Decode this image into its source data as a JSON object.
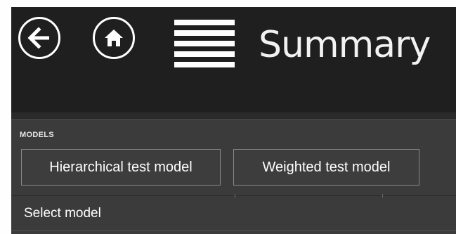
{
  "header": {
    "back_icon": "back-arrow-icon",
    "home_icon": "home-icon",
    "menu_icon": "hamburger-menu-icon",
    "title": "Summary"
  },
  "models_section": {
    "label": "MODELS",
    "models": [
      {
        "label": "Hierarchical test model"
      },
      {
        "label": "Weighted test model"
      }
    ]
  },
  "select_row": {
    "label": "Select model"
  },
  "colors": {
    "background": "#1f1f1f",
    "panel": "#3b3b3b",
    "text": "#ffffff",
    "button_border": "#8a8a8a"
  }
}
